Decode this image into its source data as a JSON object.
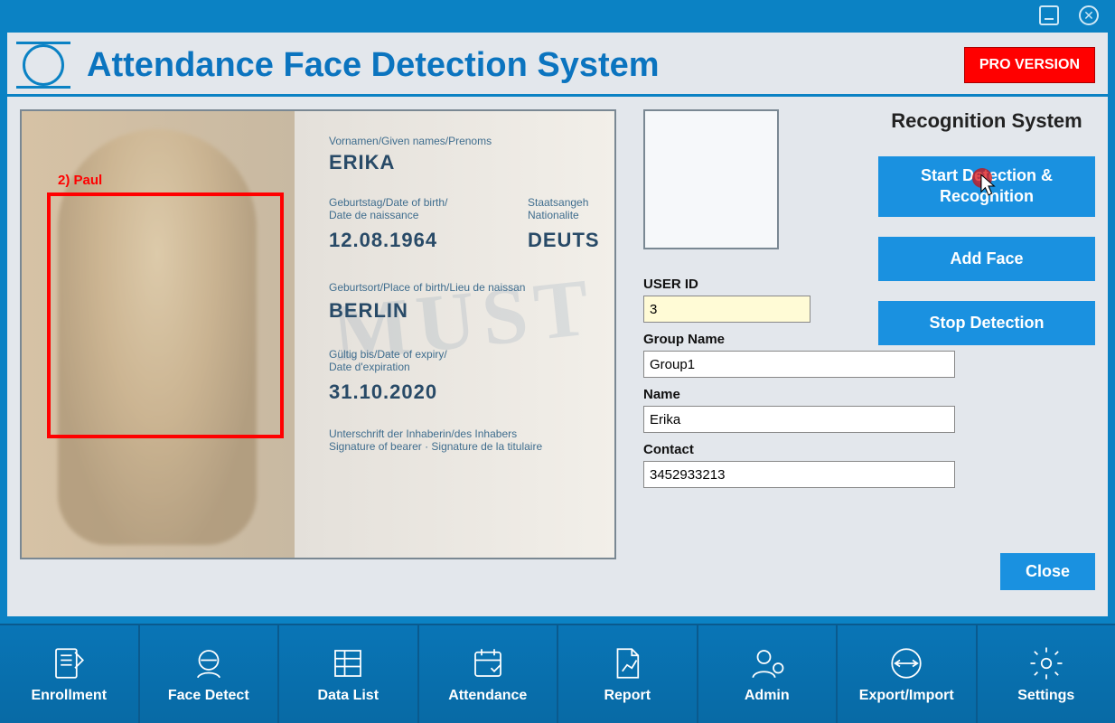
{
  "app_title": "Attendance Face Detection System",
  "pro_button": "PRO VERSION",
  "recognition_title": "Recognition System",
  "buttons": {
    "start": "Start Detection & Recognition",
    "add_face": "Add Face",
    "stop": "Stop Detection",
    "close": "Close"
  },
  "detection": {
    "face_label": "2) Paul"
  },
  "id_card": {
    "given_label": "Vornamen/Given names/Prenoms",
    "given_value": "ERIKA",
    "dob_label": "Geburtstag/Date of birth/\nDate de naissance",
    "dob_value": "12.08.1964",
    "nation_label": "Staatsangeh\nNationalite",
    "nation_value": "DEUTS",
    "pob_label": "Geburtsort/Place of birth/Lieu de naissan",
    "pob_value": "BERLIN",
    "exp_label": "Gültig bis/Date of expiry/\nDate d'expiration",
    "exp_value": "31.10.2020",
    "sig_label": "Unterschrift der Inhaberin/des Inhabers\nSignature of bearer · Signature de la titulaire",
    "watermark": "MUST"
  },
  "fields": {
    "user_id_label": "USER ID",
    "user_id_value": "3",
    "group_label": "Group Name",
    "group_value": "Group1",
    "name_label": "Name",
    "name_value": "Erika",
    "contact_label": "Contact",
    "contact_value": "3452933213"
  },
  "nav": {
    "enrollment": "Enrollment",
    "face_detect": "Face Detect",
    "data_list": "Data List",
    "attendance": "Attendance",
    "report": "Report",
    "admin": "Admin",
    "export": "Export/Import",
    "settings": "Settings"
  }
}
